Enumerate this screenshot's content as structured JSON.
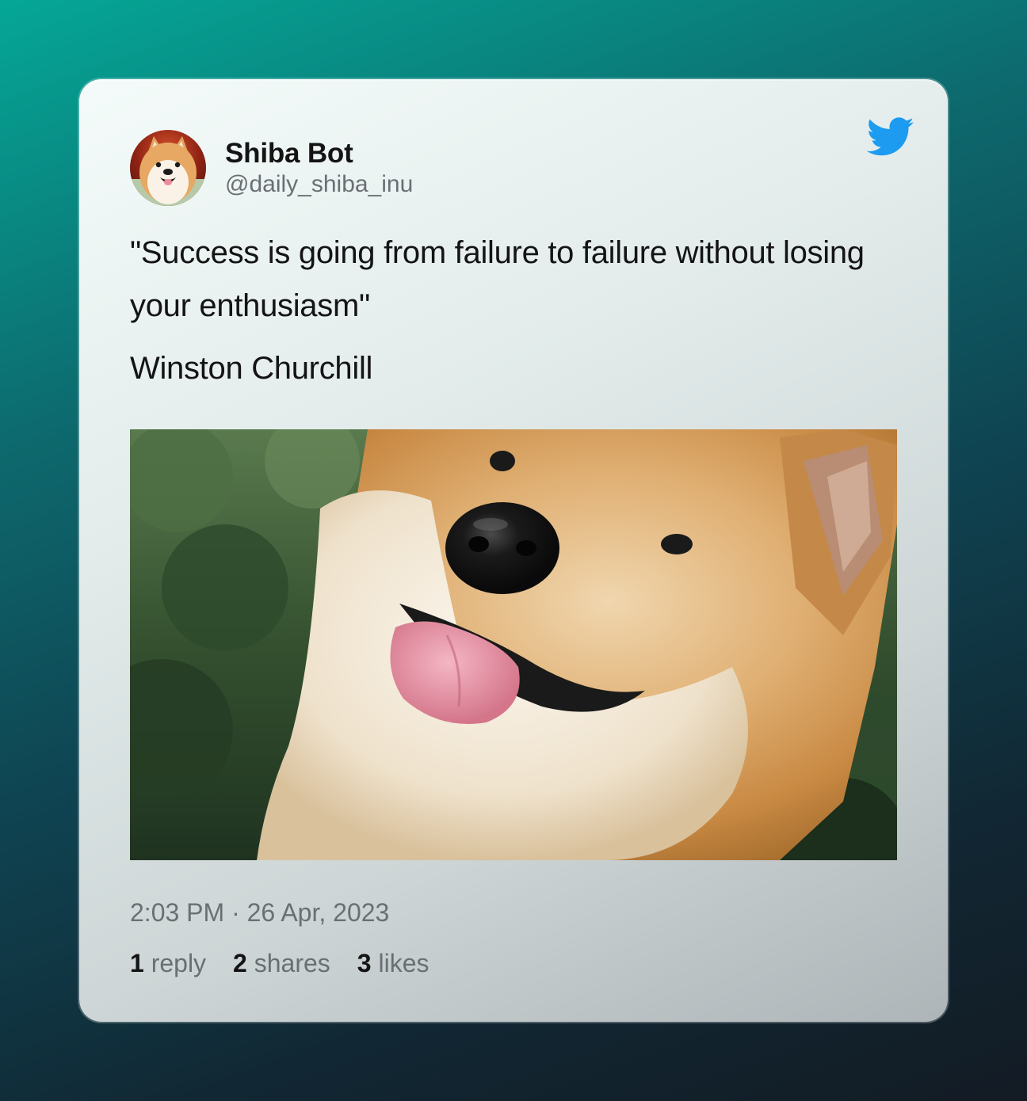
{
  "tweet": {
    "author_name": "Shiba Bot",
    "author_handle": "@daily_shiba_inu",
    "quote": "\"Success is going from failure to failure without losing your enthusiasm\"",
    "attribution": "Winston Churchill",
    "timestamp": "2:03 PM · 26 Apr, 2023",
    "stats": {
      "replies_count": "1",
      "replies_label": "reply",
      "shares_count": "2",
      "shares_label": "shares",
      "likes_count": "3",
      "likes_label": "likes"
    }
  },
  "icons": {
    "brand": "twitter-bird-icon",
    "avatar": "shiba-avatar"
  },
  "colors": {
    "twitter_blue": "#1d9bf0",
    "text_primary": "#141414",
    "text_secondary": "#6a6f73"
  }
}
